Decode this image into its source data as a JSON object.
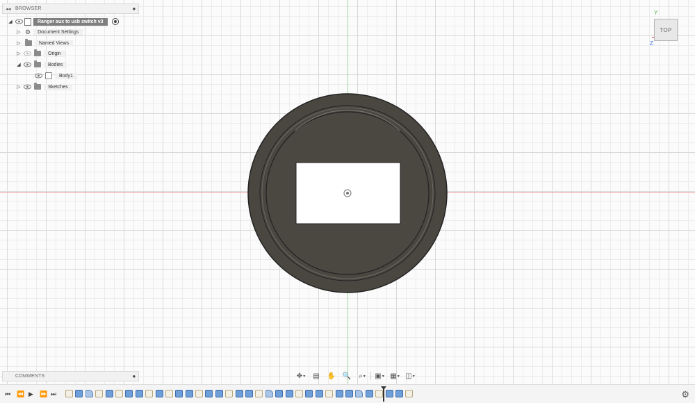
{
  "browser": {
    "title": "BROWSER",
    "root_label": "Ranger aux to usb switch v3",
    "items": [
      {
        "label": "Document Settings",
        "icon": "gear-icon"
      },
      {
        "label": "Named Views",
        "icon": "folder-icon"
      },
      {
        "label": "Origin",
        "icon": "folder-icon"
      },
      {
        "label": "Bodies",
        "icon": "folder-icon"
      },
      {
        "label": "Body1",
        "icon": "body-icon"
      },
      {
        "label": "Sketches",
        "icon": "folder-icon"
      }
    ]
  },
  "comments": {
    "title": "COMMENTS"
  },
  "viewcube": {
    "face": "TOP",
    "y_axis": "Y",
    "z_axis": "Z"
  },
  "navbar": {
    "tools": [
      "orbit-icon",
      "look-at-icon",
      "pan-icon",
      "zoom-icon",
      "fit-icon",
      "display-settings-icon",
      "grid-snaps-icon",
      "viewports-icon"
    ]
  },
  "timeline": {
    "controls": [
      "go-to-start",
      "step-back",
      "play",
      "step-forward",
      "go-to-end"
    ],
    "features": [
      "sketch",
      "extrude",
      "revolve",
      "sketch",
      "extrude",
      "sketch",
      "extrude",
      "extrude",
      "sketch",
      "extrude",
      "sketch",
      "extrude",
      "extrude",
      "sketch",
      "extrude",
      "extrude",
      "sketch",
      "extrude",
      "extrude",
      "sketch",
      "revolve",
      "extrude",
      "extrude",
      "sketch",
      "extrude",
      "extrude",
      "sketch",
      "extrude",
      "extrude",
      "revolve",
      "extrude",
      "sketch",
      "extrude",
      "extrude",
      "sketch"
    ]
  },
  "colors": {
    "part_body": "#4a4741",
    "part_edge": "#2a2825",
    "x_axis": "#f0a3a3",
    "y_axis": "#9ad89a"
  }
}
